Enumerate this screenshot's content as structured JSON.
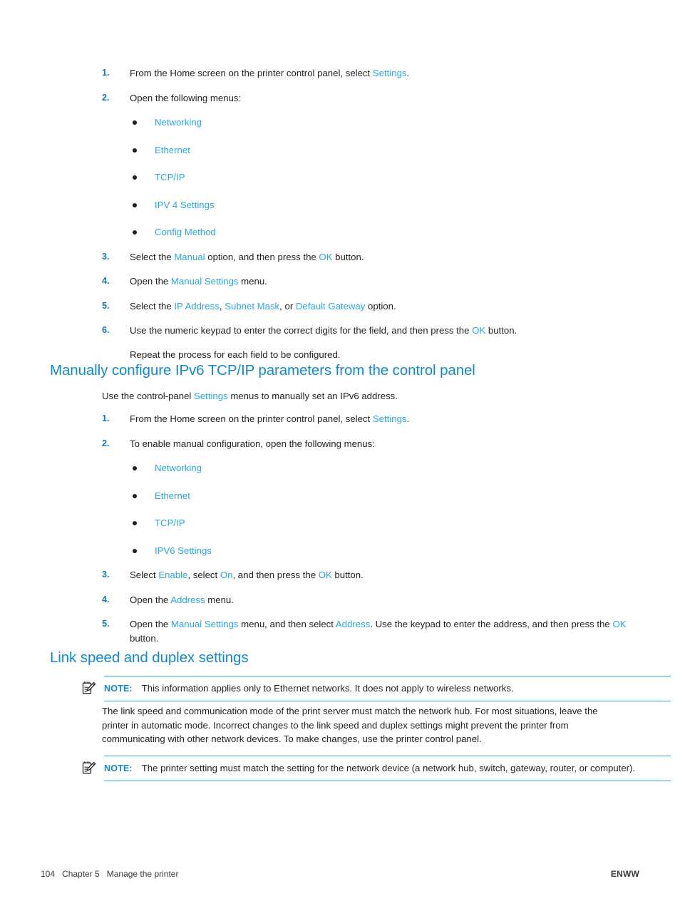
{
  "colors": {
    "link": "#2ba6e0",
    "heading": "#1389cc",
    "step_number": "#0b79be",
    "body_text": "#231f20",
    "note_rule": "#2ba6e0"
  },
  "section_ipv4_steps": {
    "items": [
      {
        "num": "1.",
        "parts": [
          {
            "t": "From the Home screen on the printer control panel, select ",
            "k": "plain"
          },
          {
            "t": "Settings",
            "k": "link"
          },
          {
            "t": ".",
            "k": "plain"
          }
        ]
      },
      {
        "num": "2.",
        "parts": [
          {
            "t": "Open the following menus:",
            "k": "plain"
          }
        ],
        "bullets": [
          "Networking",
          "Ethernet",
          "TCP/IP",
          "IPV 4 Settings",
          "Config Method"
        ]
      },
      {
        "num": "3.",
        "parts": [
          {
            "t": "Select the ",
            "k": "plain"
          },
          {
            "t": "Manual",
            "k": "link"
          },
          {
            "t": " option, and then press the ",
            "k": "plain"
          },
          {
            "t": "OK",
            "k": "link"
          },
          {
            "t": " button.",
            "k": "plain"
          }
        ]
      },
      {
        "num": "4.",
        "parts": [
          {
            "t": "Open the ",
            "k": "plain"
          },
          {
            "t": "Manual Settings",
            "k": "link"
          },
          {
            "t": " menu.",
            "k": "plain"
          }
        ]
      },
      {
        "num": "5.",
        "parts": [
          {
            "t": "Select the ",
            "k": "plain"
          },
          {
            "t": "IP Address",
            "k": "link"
          },
          {
            "t": ", ",
            "k": "plain"
          },
          {
            "t": "Subnet Mask",
            "k": "link"
          },
          {
            "t": ", or ",
            "k": "plain"
          },
          {
            "t": "Default Gateway",
            "k": "link"
          },
          {
            "t": " option.",
            "k": "plain"
          }
        ]
      },
      {
        "num": "6.",
        "parts": [
          {
            "t": "Use the numeric keypad to enter the correct digits for the field, and then press the ",
            "k": "plain"
          },
          {
            "t": "OK",
            "k": "link"
          },
          {
            "t": " button.",
            "k": "plain"
          }
        ],
        "extra_paragraph": "Repeat the process for each field to be configured."
      }
    ]
  },
  "section_ipv6": {
    "heading": "Manually configure IPv6 TCP/IP parameters from the control panel",
    "intro_parts": [
      {
        "t": "Use the control-panel ",
        "k": "plain"
      },
      {
        "t": "Settings",
        "k": "link"
      },
      {
        "t": " menus to manually set an IPv6 address.",
        "k": "plain"
      }
    ],
    "items": [
      {
        "num": "1.",
        "parts": [
          {
            "t": "From the Home screen on the printer control panel, select ",
            "k": "plain"
          },
          {
            "t": "Settings",
            "k": "link"
          },
          {
            "t": ".",
            "k": "plain"
          }
        ]
      },
      {
        "num": "2.",
        "parts": [
          {
            "t": "To enable manual configuration, open the following menus:",
            "k": "plain"
          }
        ],
        "bullets": [
          "Networking",
          "Ethernet",
          "TCP/IP",
          "IPV6 Settings"
        ]
      },
      {
        "num": "3.",
        "parts": [
          {
            "t": "Select ",
            "k": "plain"
          },
          {
            "t": "Enable",
            "k": "link"
          },
          {
            "t": ", select ",
            "k": "plain"
          },
          {
            "t": "On",
            "k": "link"
          },
          {
            "t": ", and then press the ",
            "k": "plain"
          },
          {
            "t": "OK",
            "k": "link"
          },
          {
            "t": " button.",
            "k": "plain"
          }
        ]
      },
      {
        "num": "4.",
        "parts": [
          {
            "t": "Open the ",
            "k": "plain"
          },
          {
            "t": "Address",
            "k": "link"
          },
          {
            "t": " menu.",
            "k": "plain"
          }
        ]
      },
      {
        "num": "5.",
        "parts": [
          {
            "t": "Open the ",
            "k": "plain"
          },
          {
            "t": "Manual Settings",
            "k": "link"
          },
          {
            "t": " menu, and then select ",
            "k": "plain"
          },
          {
            "t": "Address",
            "k": "link"
          },
          {
            "t": ". Use the keypad to enter the address, and then press the ",
            "k": "plain"
          },
          {
            "t": "OK",
            "k": "link"
          },
          {
            "t": " button.",
            "k": "plain"
          }
        ]
      }
    ]
  },
  "section_link_speed": {
    "heading": "Link speed and duplex settings",
    "note_1": {
      "icon": "note-pad-pencil-icon",
      "label": "NOTE:",
      "text": "This information applies only to Ethernet networks. It does not apply to wireless networks."
    },
    "paragraph": "The link speed and communication mode of the print server must match the network hub. For most situations, leave the printer in automatic mode. Incorrect changes to the link speed and duplex settings might prevent the printer from communicating with other network devices. To make changes, use the printer control panel.",
    "note_2": {
      "icon": "note-pad-pencil-icon",
      "label": "NOTE:",
      "text": "The printer setting must match the setting for the network device (a network hub, switch, gateway, router, or computer)."
    }
  },
  "footer": {
    "left": "104   Chapter 5   Manage the printer",
    "right": "ENWW"
  }
}
